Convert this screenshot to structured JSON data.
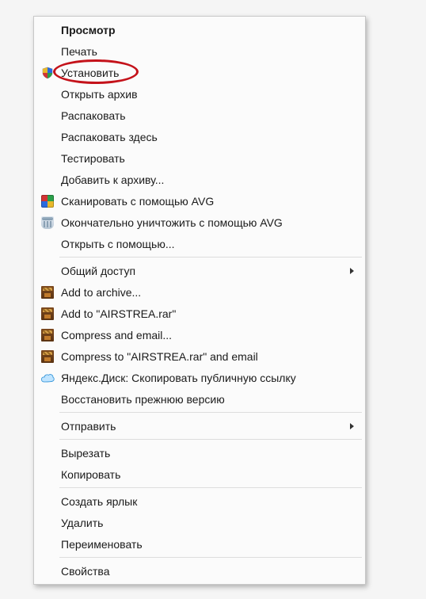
{
  "menu": {
    "groups": [
      [
        {
          "id": "view",
          "label": "Просмотр",
          "bold": true
        },
        {
          "id": "print",
          "label": "Печать"
        },
        {
          "id": "install",
          "label": "Установить",
          "icon": "shield",
          "highlight": true
        },
        {
          "id": "open-archive",
          "label": "Открыть архив"
        },
        {
          "id": "extract",
          "label": "Распаковать"
        },
        {
          "id": "extract-here",
          "label": "Распаковать здесь"
        },
        {
          "id": "test",
          "label": "Тестировать"
        },
        {
          "id": "add-to-archive-ru",
          "label": "Добавить к архиву..."
        },
        {
          "id": "avg-scan",
          "label": "Сканировать с помощью AVG",
          "icon": "avg"
        },
        {
          "id": "avg-shred",
          "label": "Окончательно уничтожить с помощью AVG",
          "icon": "shred"
        },
        {
          "id": "open-with",
          "label": "Открыть с помощью..."
        }
      ],
      [
        {
          "id": "sharing",
          "label": "Общий доступ",
          "submenu": true
        },
        {
          "id": "add-to-archive",
          "label": "Add to archive...",
          "icon": "winrar"
        },
        {
          "id": "add-to-named-rar",
          "label": "Add to \"AIRSTREA.rar\"",
          "icon": "winrar"
        },
        {
          "id": "compress-email",
          "label": "Compress and email...",
          "icon": "winrar"
        },
        {
          "id": "compress-named-email",
          "label": "Compress to \"AIRSTREA.rar\" and email",
          "icon": "winrar"
        },
        {
          "id": "yadisk-copy-link",
          "label": "Яндекс.Диск: Скопировать публичную ссылку",
          "icon": "cloud"
        },
        {
          "id": "restore-previous",
          "label": "Восстановить прежнюю версию"
        }
      ],
      [
        {
          "id": "send-to",
          "label": "Отправить",
          "submenu": true
        }
      ],
      [
        {
          "id": "cut",
          "label": "Вырезать"
        },
        {
          "id": "copy",
          "label": "Копировать"
        }
      ],
      [
        {
          "id": "create-shortcut",
          "label": "Создать ярлык"
        },
        {
          "id": "delete",
          "label": "Удалить"
        },
        {
          "id": "rename",
          "label": "Переименовать"
        }
      ],
      [
        {
          "id": "properties",
          "label": "Свойства"
        }
      ]
    ]
  }
}
